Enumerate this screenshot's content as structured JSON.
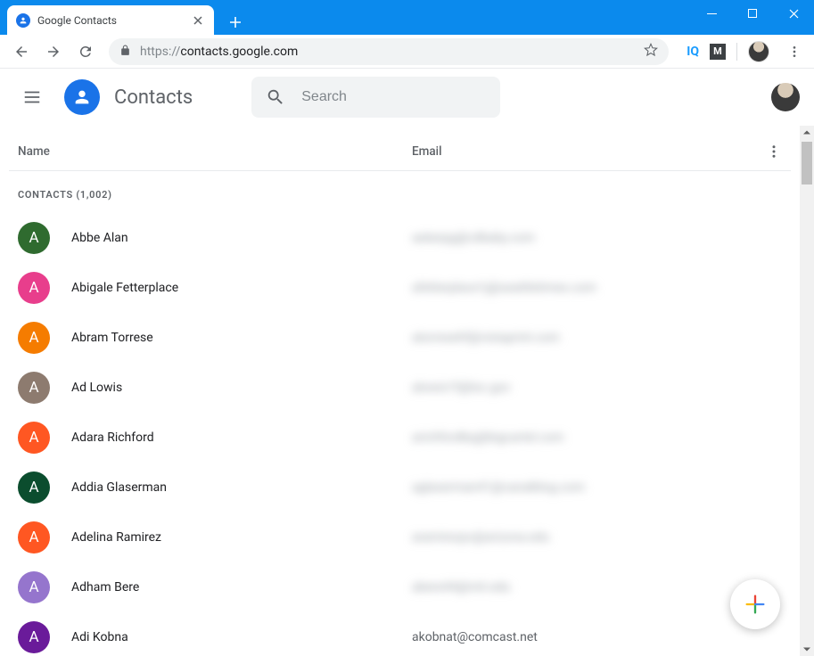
{
  "browser": {
    "tab_title": "Google Contacts",
    "url_prefix": "https://",
    "url_host": "contacts.google.com"
  },
  "app": {
    "title": "Contacts",
    "search_placeholder": "Search"
  },
  "columns": {
    "name": "Name",
    "email": "Email"
  },
  "section_label": "CONTACTS (1,002)",
  "contacts": [
    {
      "initial": "A",
      "name": "Abbe Alan",
      "email": "aalanpg@cdbaby.com",
      "color": "#2f6b2f",
      "blurred": true
    },
    {
      "initial": "A",
      "name": "Abigale Fetterplace",
      "email": "afetterplace1j@seattletimes.com",
      "color": "#e83e8c",
      "blurred": true
    },
    {
      "initial": "A",
      "name": "Abram Torrese",
      "email": "atorresehf@vistaprint.com",
      "color": "#f57c00",
      "blurred": true
    },
    {
      "initial": "A",
      "name": "Ad Lowis",
      "email": "alowis1f@loc.gov",
      "color": "#8d7b6f",
      "blurred": true
    },
    {
      "initial": "A",
      "name": "Adara Richford",
      "email": "arichfordbq@bigcartel.com",
      "color": "#ff5722",
      "blurred": true
    },
    {
      "initial": "A",
      "name": "Addia Glaserman",
      "email": "aglaserman41@canalblog.com",
      "color": "#0b4d2e",
      "blurred": true
    },
    {
      "initial": "A",
      "name": "Adelina Ramirez",
      "email": "aramirezpv@arizona.edu",
      "color": "#ff5722",
      "blurred": true
    },
    {
      "initial": "A",
      "name": "Adham Bere",
      "email": "abere44@mit.edu",
      "color": "#9575cd",
      "blurred": true
    },
    {
      "initial": "A",
      "name": "Adi Kobna",
      "email": "akobnat@comcast.net",
      "color": "#6a1b9a",
      "blurred": false
    }
  ]
}
